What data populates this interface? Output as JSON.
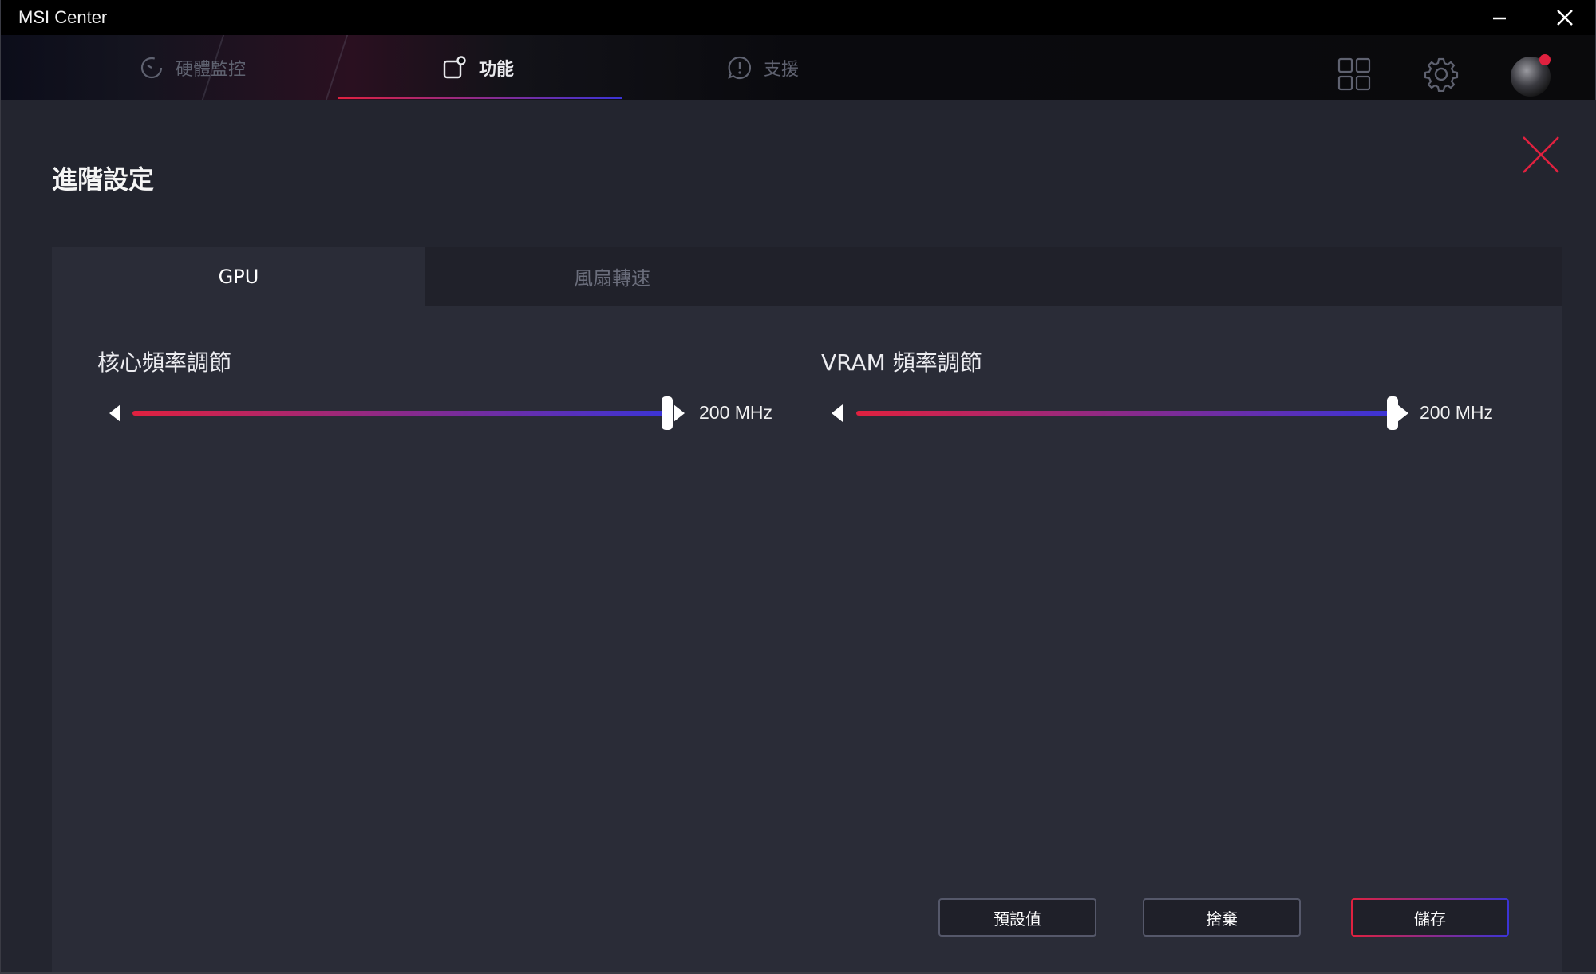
{
  "window": {
    "title": "MSI Center",
    "minimize_icon": "minimize-icon",
    "close_icon": "close-icon"
  },
  "nav": {
    "tabs": [
      {
        "label": "硬體監控",
        "icon": "monitor-gauge-icon",
        "active": false
      },
      {
        "label": "功能",
        "icon": "features-icon",
        "active": true
      },
      {
        "label": "支援",
        "icon": "support-chat-icon",
        "active": false
      }
    ],
    "right_icons": [
      "grid-apps-icon",
      "gear-icon",
      "avatar"
    ]
  },
  "page": {
    "title": "進階設定",
    "close_icon": "close-x-icon"
  },
  "tabs": [
    {
      "label": "GPU",
      "active": true
    },
    {
      "label": "風扇轉速",
      "active": false
    }
  ],
  "sliders": [
    {
      "label": "核心頻率調節",
      "value": "200 MHz",
      "position": 1.0
    },
    {
      "label": "VRAM 頻率調節",
      "value": "200 MHz",
      "position": 1.0
    }
  ],
  "buttons": {
    "default_label": "預設值",
    "discard_label": "捨棄",
    "save_label": "儲存"
  },
  "colors": {
    "accent_red": "#e0213f",
    "accent_blue": "#3b34d6",
    "panel": "#2a2c37",
    "background": "#23252f"
  }
}
